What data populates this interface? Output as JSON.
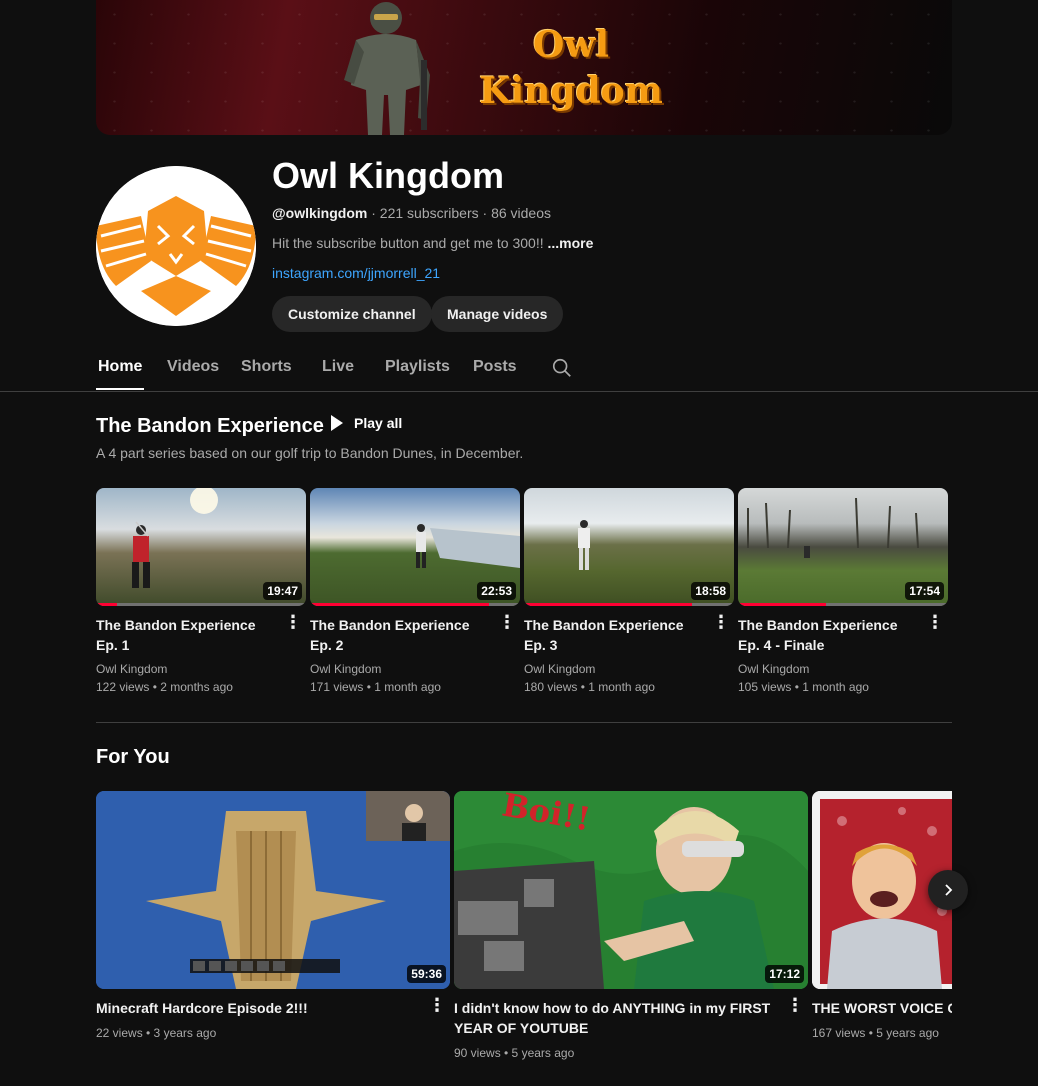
{
  "channel": {
    "name": "Owl Kingdom",
    "banner_text_line1": "Owl",
    "banner_text_line2": "Kingdom",
    "handle": "@owlkingdom",
    "subscribers": "221 subscribers",
    "video_count": "86 videos",
    "separator": "·",
    "description": "Hit the subscribe button and get me to 300!!",
    "more_label": "...more",
    "link": "instagram.com/jjmorrell_21",
    "customize_label": "Customize channel",
    "manage_label": "Manage videos",
    "brand_color": "#f7931e"
  },
  "tabs": [
    {
      "label": "Home",
      "active": true
    },
    {
      "label": "Videos"
    },
    {
      "label": "Shorts"
    },
    {
      "label": "Live"
    },
    {
      "label": "Playlists"
    },
    {
      "label": "Posts"
    }
  ],
  "playlist_section": {
    "title": "The Bandon Experience",
    "play_all_label": "Play all",
    "description": "A 4 part series based on our golf trip to Bandon Dunes, in December.",
    "videos": [
      {
        "title": "The Bandon Experience Ep. 1",
        "channel": "Owl Kingdom",
        "stats": "122 views • 2 months ago",
        "duration": "19:47",
        "watched_fraction": 0.1
      },
      {
        "title": "The Bandon Experience Ep. 2",
        "channel": "Owl Kingdom",
        "stats": "171 views • 1 month ago",
        "duration": "22:53",
        "watched_fraction": 0.85
      },
      {
        "title": "The Bandon Experience Ep. 3",
        "channel": "Owl Kingdom",
        "stats": "180 views • 1 month ago",
        "duration": "18:58",
        "watched_fraction": 0.8
      },
      {
        "title": "The Bandon Experience Ep. 4 - Finale",
        "channel": "Owl Kingdom",
        "stats": "105 views • 1 month ago",
        "duration": "17:54",
        "watched_fraction": 0.42
      }
    ]
  },
  "for_you_section": {
    "title": "For You",
    "videos": [
      {
        "title": "Minecraft Hardcore Episode 2!!!",
        "stats": "22 views • 3 years ago",
        "duration": "59:36"
      },
      {
        "title": "I didn't know how to do ANYTHING in my FIRST YEAR OF YOUTUBE",
        "stats": "90 views • 5 years ago",
        "duration": "17:12",
        "thumb_caption": "Boi!!"
      },
      {
        "title": "THE WORST VOICE CR",
        "stats": "167 views • 5 years ago"
      }
    ]
  }
}
